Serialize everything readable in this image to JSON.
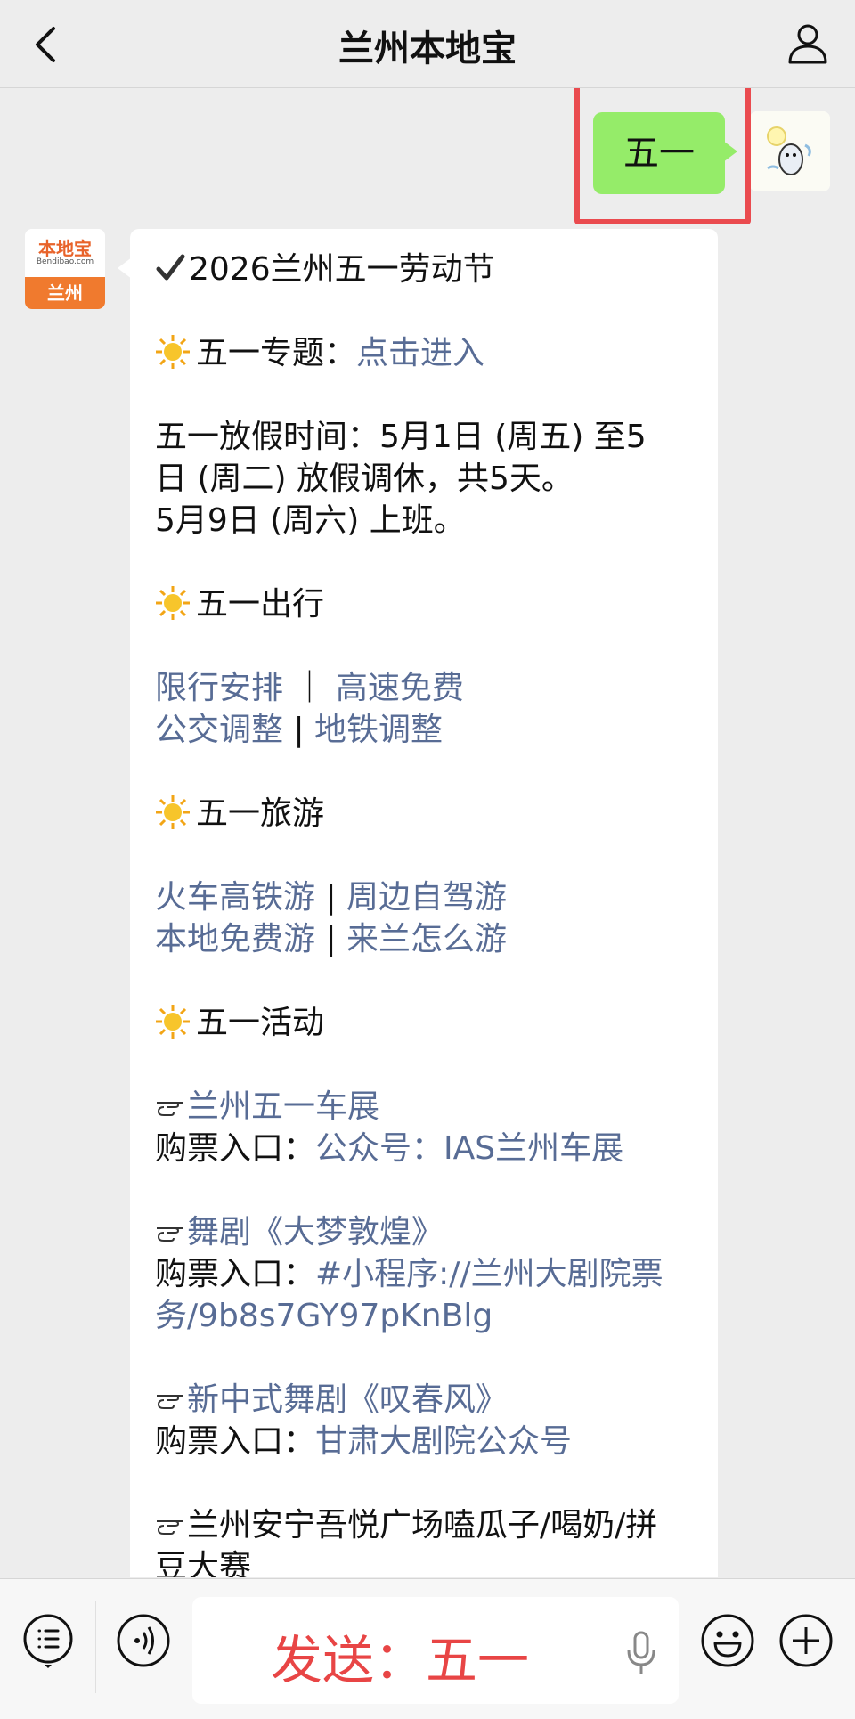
{
  "header": {
    "title": "兰州本地宝"
  },
  "my_message": {
    "text": "五一"
  },
  "bot_avatar": {
    "logo_text": "本地宝",
    "logo_sub": "Bendibao.com",
    "city": "兰州"
  },
  "bot_message": {
    "title": "2026兰州五一劳动节",
    "topic_prefix": "五一专题：",
    "topic_link": "点击进入",
    "holiday_line1": "五一放假时间：5月1日 (周五) 至5",
    "holiday_line2": "日 (周二) 放假调休，共5天。",
    "holiday_line3": "5月9日 (周六) 上班。",
    "travel_heading": "五一出行",
    "travel_links": [
      "限行安排",
      "高速免费",
      "公交调整",
      "地铁调整"
    ],
    "tour_heading": "五一旅游",
    "tour_links": [
      "火车高铁游",
      "周边自驾游",
      "本地免费游",
      "来兰怎么游"
    ],
    "activity_heading": "五一活动",
    "separator": " | ",
    "separator_wide": " ｜ ",
    "ticket_label": "购票入口：",
    "events": [
      {
        "name": "兰州五一车展",
        "ticket": "公众号：IAS兰州车展"
      },
      {
        "name": "舞剧《大梦敦煌》",
        "ticket_line1": "#小程序://兰州大剧院票",
        "ticket_line2": "务/9b8s7GY97pKnBlg"
      },
      {
        "name": "新中式舞剧《叹春风》",
        "ticket": "甘肃大剧院公众号"
      },
      {
        "name_line1": "兰州安宁吾悦广场嗑瓜子/喝奶/拼",
        "name_line2": "豆大赛"
      }
    ]
  },
  "input": {
    "text": "发送：五一"
  },
  "colors": {
    "link": "#586c95",
    "my_bubble": "#95ec69",
    "highlight": "#ea4b4f",
    "input_text": "#e84545"
  }
}
